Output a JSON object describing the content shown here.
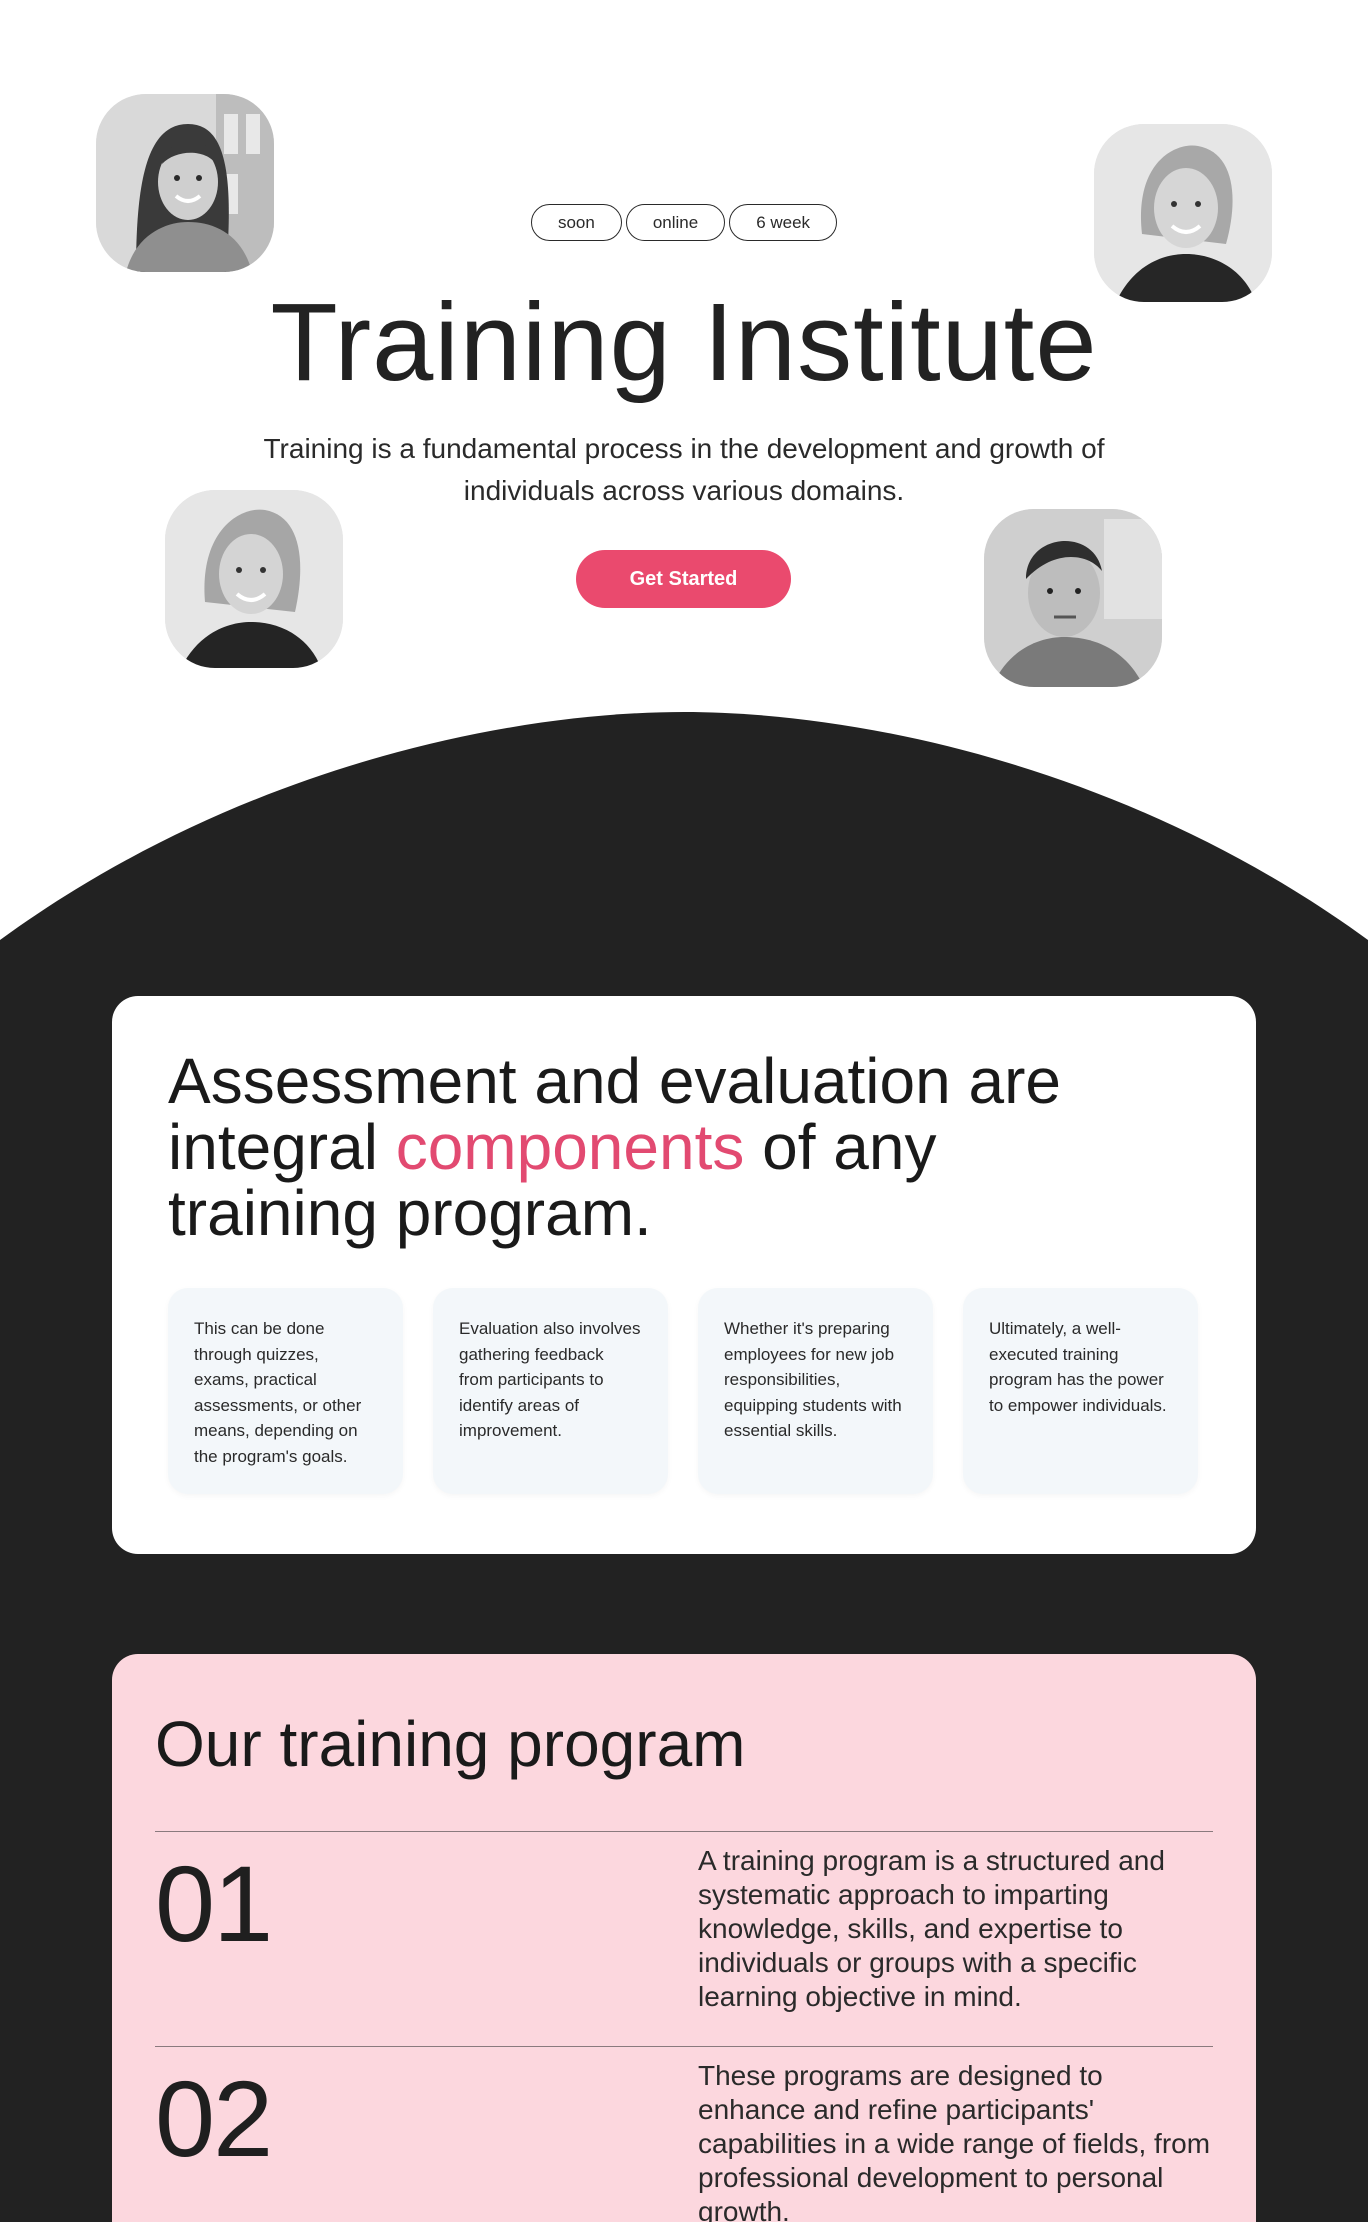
{
  "hero": {
    "tags": [
      "soon",
      "online",
      "6 week"
    ],
    "title": "Training Institute",
    "subtitle": "Training is a fundamental process in the development and growth of individuals across various domains.",
    "cta_label": "Get Started"
  },
  "assessment": {
    "title_part1": "Assessment and evaluation are integral ",
    "title_accent": "components",
    "title_part2": " of any training program.",
    "cards": [
      "This can be done through quizzes, exams, practical assessments, or other means, depending on the program's goals.",
      "Evaluation also involves gathering feedback from participants to identify areas of improvement.",
      "Whether it's preparing employees for new job responsibilities, equipping students with essential skills.",
      "Ultimately, a well-executed training program has the power to empower individuals."
    ]
  },
  "program": {
    "title": "Our training program",
    "rows": [
      {
        "number": "01",
        "text": "A training program is a structured and systematic approach to imparting knowledge, skills, and expertise to individuals or groups with a specific learning objective in mind."
      },
      {
        "number": "02",
        "text": "These programs are designed to enhance and refine participants' capabilities in a wide range of fields, from professional development to personal growth."
      }
    ]
  },
  "colors": {
    "accent": "#ea4a6e",
    "dark": "#222222",
    "pink_card": "#fcd7de",
    "mini_card": "#f3f7fa"
  }
}
